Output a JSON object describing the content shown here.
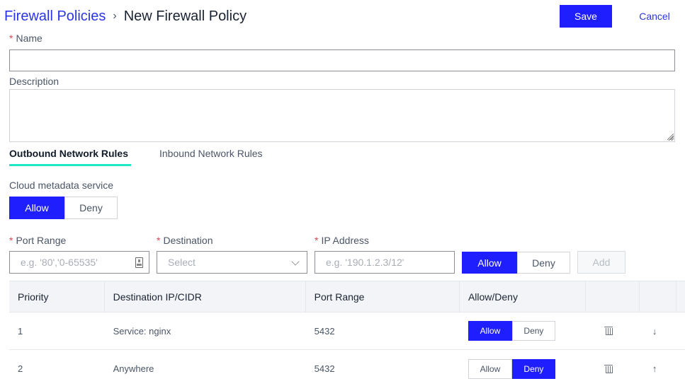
{
  "breadcrumb": {
    "parent": "Firewall Policies",
    "separator": "›",
    "current": "New Firewall Policy"
  },
  "toolbar": {
    "save_label": "Save",
    "cancel_label": "Cancel"
  },
  "form": {
    "name_label": "Name",
    "name_value": "",
    "description_label": "Description",
    "description_value": "",
    "required_mark": "*"
  },
  "tabs": [
    {
      "label": "Outbound Network Rules",
      "active": true
    },
    {
      "label": "Inbound Network Rules",
      "active": false
    }
  ],
  "metadata_service": {
    "label": "Cloud metadata service",
    "options": [
      "Allow",
      "Deny"
    ],
    "selected": "Allow"
  },
  "new_rule": {
    "port_range_label": "Port Range",
    "port_range_placeholder": "e.g. '80','0-65535'",
    "destination_label": "Destination",
    "destination_placeholder": "Select",
    "ip_label": "IP Address",
    "ip_placeholder": "e.g. '190.1.2.3/12'",
    "action_options": [
      "Allow",
      "Deny"
    ],
    "action_selected": "Allow",
    "add_label": "Add"
  },
  "table": {
    "columns": [
      "Priority",
      "Destination IP/CIDR",
      "Port Range",
      "Allow/Deny",
      "",
      "",
      ""
    ],
    "rows": [
      {
        "priority": "1",
        "destination": "Service: nginx",
        "port_range": "5432",
        "action": "Allow",
        "options": [
          "Allow",
          "Deny"
        ],
        "move_icon": "arrow-down-icon",
        "move_glyph": "↓"
      },
      {
        "priority": "2",
        "destination": "Anywhere",
        "port_range": "5432",
        "action": "Deny",
        "options": [
          "Allow",
          "Deny"
        ],
        "move_icon": "arrow-up-icon",
        "move_glyph": "↑"
      }
    ]
  },
  "colors": {
    "primary": "#1e1eff",
    "link": "#2b35e6",
    "tab_indicator": "#1de9c6",
    "required": "#e8424f"
  }
}
